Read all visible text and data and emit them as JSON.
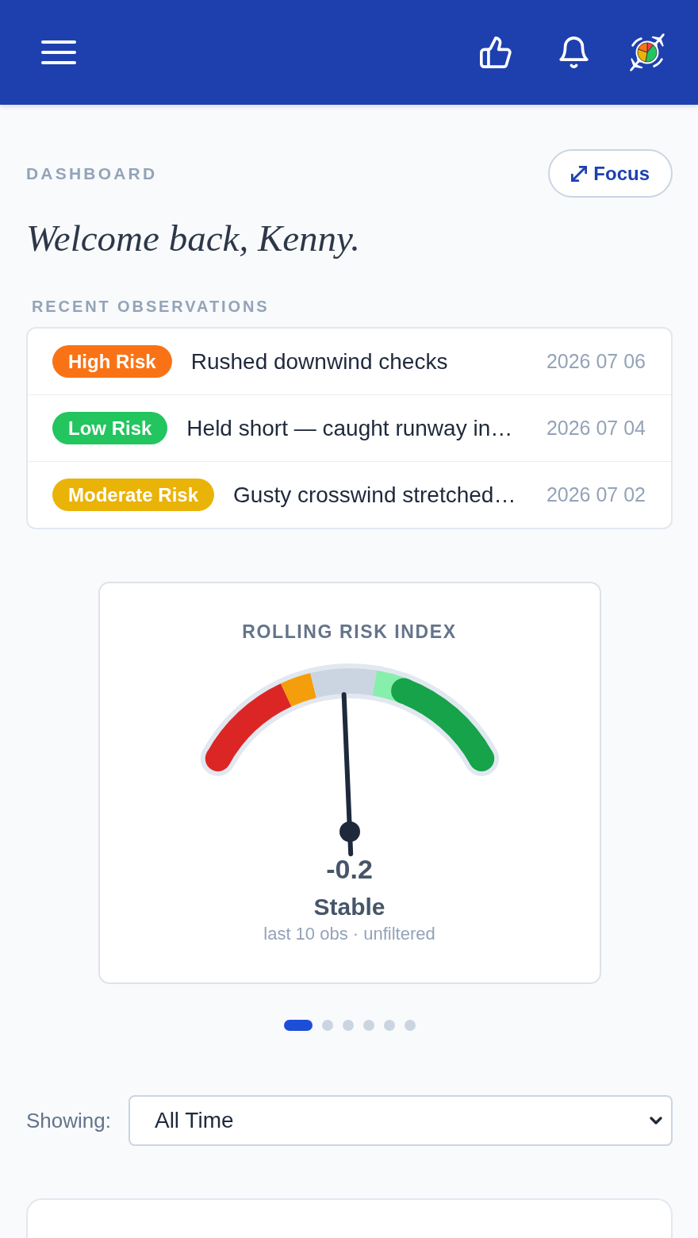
{
  "page": {
    "eyebrow": "DASHBOARD",
    "focus_button": "Focus",
    "greeting": "Welcome back, Kenny."
  },
  "recent_observations": {
    "heading": "RECENT OBSERVATIONS",
    "items": [
      {
        "risk": "High Risk",
        "color": "#f97316",
        "title": "Rushed downwind checks",
        "date": "2026 07 06"
      },
      {
        "risk": "Low Risk",
        "color": "#22c55e",
        "title": "Held short — caught runway in…",
        "date": "2026 07 04"
      },
      {
        "risk": "Moderate Risk",
        "color": "#eab308",
        "title": "Gusty crosswind stretched…",
        "date": "2026 07 02"
      }
    ]
  },
  "risk_gauge": {
    "title": "ROLLING RISK INDEX",
    "level": 0.48,
    "value": "-0.2",
    "status": "Stable",
    "caption": "last 10 obs · unfiltered"
  },
  "carousel": {
    "pages": [
      {
        "selected": true
      },
      {
        "selected": false
      },
      {
        "selected": false
      },
      {
        "selected": false
      },
      {
        "selected": false
      },
      {
        "selected": false
      }
    ]
  },
  "filter": {
    "label": "Showing:",
    "value": "All Time"
  }
}
